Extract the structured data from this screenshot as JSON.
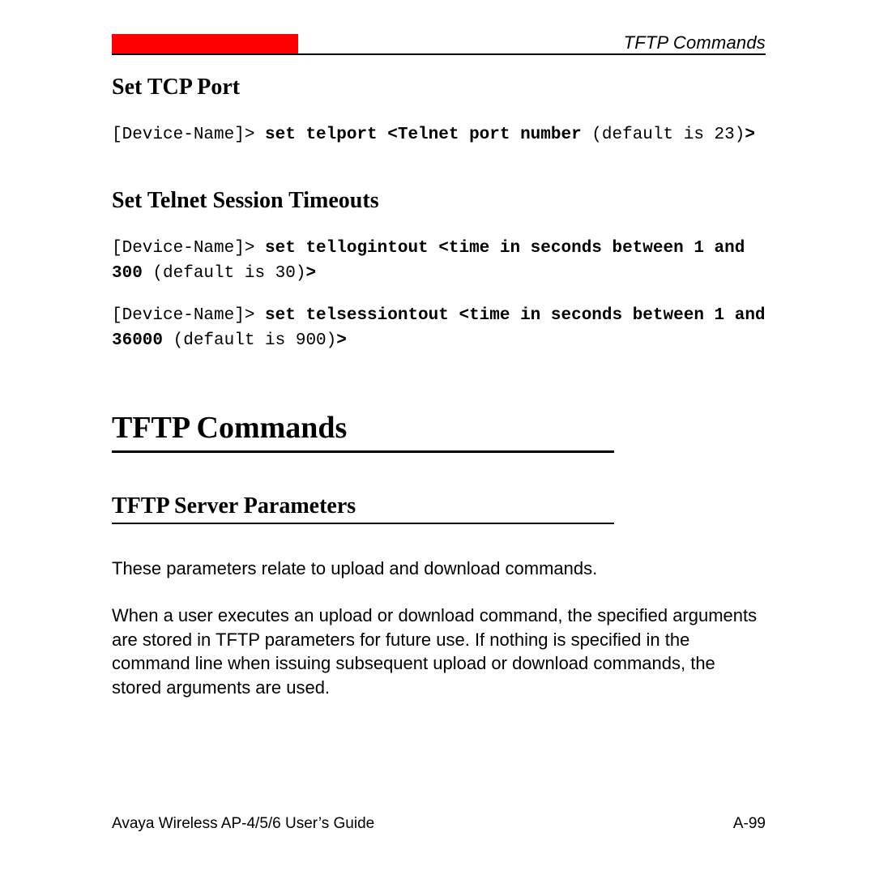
{
  "header": {
    "breadcrumb": "TFTP Commands"
  },
  "section1": {
    "heading": "Set TCP Port",
    "prompt1_pre": "[Device-Name]> ",
    "prompt1_bold": "set telport <Telnet port number ",
    "prompt1_post": "(default is 23)",
    "prompt1_end": ">"
  },
  "section2": {
    "heading": "Set Telnet Session Timeouts",
    "line1_pre": "[Device-Name]> ",
    "line1_bold": "set tellogintout <time in seconds between 1 and 300 ",
    "line1_mid": "(default is 30)",
    "line1_end": ">",
    "line2_pre": "[Device-Name]> ",
    "line2_bold": "set telsessiontout <time in seconds between 1 and 36000 ",
    "line2_mid": "(default is 900)",
    "line2_end": ">"
  },
  "main": {
    "title": "TFTP Commands",
    "subsection": "TFTP Server Parameters",
    "para1": "These parameters relate to upload and download commands.",
    "para2": "When a user executes an upload or download command, the specified arguments are stored in TFTP parameters for future use. If nothing is specified in the command line when issuing subsequent upload or download commands, the stored arguments are used."
  },
  "footer": {
    "left": "Avaya Wireless AP-4/5/6 User’s Guide",
    "right": "A-99"
  }
}
